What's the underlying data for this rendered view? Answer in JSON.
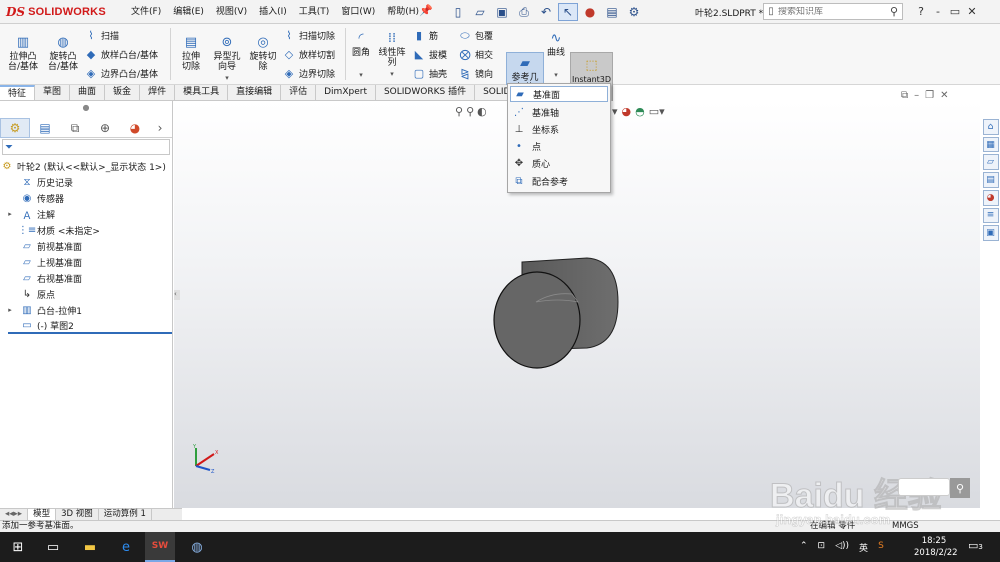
{
  "app": {
    "logo_prefix": "DS",
    "logo_text": "SOLIDWORKS",
    "menus": [
      "文件(F)",
      "编辑(E)",
      "视图(V)",
      "插入(I)",
      "工具(T)",
      "窗口(W)",
      "帮助(H)"
    ],
    "document_name": "叶轮2.SLDPRT *",
    "search_placeholder": "搜索知识库",
    "window_controls": [
      "?",
      "-",
      "▭",
      "✕"
    ]
  },
  "ribbon": {
    "extrude_boss": "拉伸凸台/基体",
    "revolve_boss": "旋转凸台/基体",
    "sweep": "扫描",
    "loft_boss": "放样凸台/基体",
    "boundary_boss": "边界凸台/基体",
    "extrude_cut": "拉伸切除",
    "hole_wizard": "异型孔向导",
    "revolve_cut": "旋转切除",
    "sweep_cut": "扫描切除",
    "loft_cut": "放样切割",
    "boundary_cut": "边界切除",
    "fillet": "圆角",
    "linear_pattern": "线性阵列",
    "rib": "筋",
    "draft": "拔模",
    "shell": "抽壳",
    "wrap": "包覆",
    "intersect": "相交",
    "mirror": "镜向",
    "reference_geometry": "参考几何体",
    "curves": "曲线",
    "instant3d": "Instant3D"
  },
  "tabs": [
    "特征",
    "草图",
    "曲面",
    "钣金",
    "焊件",
    "模具工具",
    "直接编辑",
    "评估",
    "DimXpert",
    "SOLIDWORKS 插件",
    "SOLID"
  ],
  "feature_tree": {
    "root": "叶轮2 (默认<<默认>_显示状态 1>)",
    "items": [
      {
        "label": "历史记录",
        "icon": "history-icon",
        "expandable": false
      },
      {
        "label": "传感器",
        "icon": "sensor-icon",
        "expandable": false
      },
      {
        "label": "注解",
        "icon": "annotation-icon",
        "expandable": true
      },
      {
        "label": "材质 <未指定>",
        "icon": "material-icon",
        "expandable": false
      },
      {
        "label": "前视基准面",
        "icon": "plane-icon",
        "expandable": false
      },
      {
        "label": "上视基准面",
        "icon": "plane-icon",
        "expandable": false
      },
      {
        "label": "右视基准面",
        "icon": "plane-icon",
        "expandable": false
      },
      {
        "label": "原点",
        "icon": "origin-icon",
        "expandable": false
      },
      {
        "label": "凸台-拉伸1",
        "icon": "extrude-icon",
        "expandable": true
      },
      {
        "label": "(-) 草图2",
        "icon": "sketch-icon",
        "expandable": false
      }
    ]
  },
  "flyout": {
    "items": [
      {
        "label": "基准面",
        "icon": "plane-icon"
      },
      {
        "label": "基准轴",
        "icon": "axis-icon"
      },
      {
        "label": "坐标系",
        "icon": "coordinate-system-icon"
      },
      {
        "label": "点",
        "icon": "point-icon"
      },
      {
        "label": "质心",
        "icon": "center-of-mass-icon"
      },
      {
        "label": "配合参考",
        "icon": "mate-reference-icon"
      }
    ]
  },
  "bottom_tabs": [
    "模型",
    "3D 视图",
    "运动算例 1"
  ],
  "status": {
    "message": "添加一参考基准面。",
    "editing": "在编辑 零件",
    "units": "MMGS"
  },
  "taskbar": {
    "ime": "英",
    "time": "18:25",
    "date": "2018/2/22",
    "notifications": "3"
  },
  "watermark": {
    "brand": "Baidu 经验",
    "url": "jingyan.baidu.com"
  }
}
